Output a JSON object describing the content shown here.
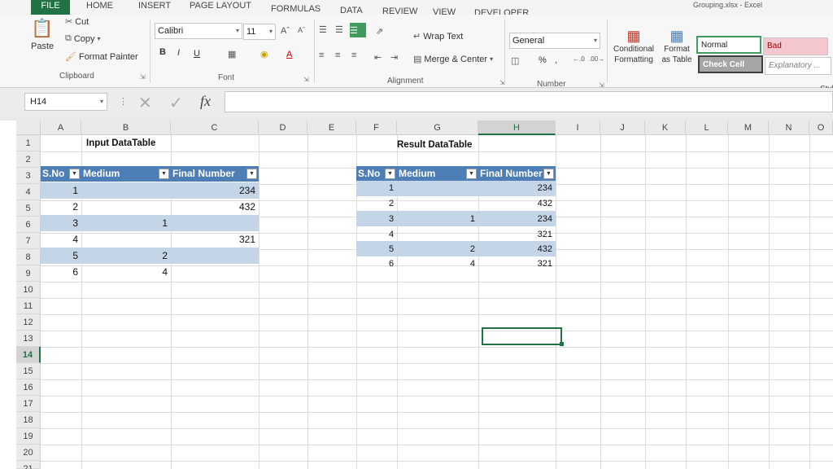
{
  "window": {
    "title": "Grouping.xlsx - Excel"
  },
  "tabs": [
    "FILE",
    "HOME",
    "INSERT",
    "PAGE LAYOUT",
    "FORMULAS",
    "DATA",
    "REVIEW",
    "VIEW",
    "DEVELOPER"
  ],
  "ribbon": {
    "clipboard": {
      "paste": "Paste",
      "cut": "Cut",
      "copy": "Copy",
      "format_painter": "Format Painter",
      "label": "Clipboard"
    },
    "font": {
      "name": "Calibri",
      "size": "11",
      "bold": "B",
      "italic": "I",
      "underline": "U",
      "label": "Font"
    },
    "alignment": {
      "wrap_text": "Wrap Text",
      "merge_center": "Merge & Center",
      "label": "Alignment"
    },
    "number": {
      "format": "General",
      "percent": "%",
      "comma": ",",
      "label": "Number"
    },
    "styles": {
      "conditional_formatting": "Conditional Formatting",
      "format_as_table": "Format as Table",
      "normal": "Normal",
      "bad": "Bad",
      "check_cell": "Check Cell",
      "explanatory": "Explanatory ...",
      "label": "Styl"
    }
  },
  "formula_bar": {
    "name_box": "H14",
    "fx": "fx",
    "value": ""
  },
  "columns": [
    "A",
    "B",
    "C",
    "D",
    "E",
    "F",
    "G",
    "H",
    "I",
    "J",
    "K",
    "L",
    "M",
    "N",
    "O"
  ],
  "rows": [
    "1",
    "2",
    "3",
    "4",
    "5",
    "6",
    "7",
    "8",
    "9",
    "10",
    "11",
    "12",
    "13",
    "14",
    "15",
    "16",
    "17",
    "18",
    "19",
    "20",
    "21"
  ],
  "active_cell": {
    "column": "H",
    "row": "14"
  },
  "input_table": {
    "title": "Input DataTable",
    "headers": [
      "S.No",
      "Medium",
      "Final Number"
    ],
    "rows": [
      {
        "sno": "1",
        "medium": "",
        "final": "234"
      },
      {
        "sno": "2",
        "medium": "",
        "final": "432"
      },
      {
        "sno": "3",
        "medium": "1",
        "final": ""
      },
      {
        "sno": "4",
        "medium": "",
        "final": "321"
      },
      {
        "sno": "5",
        "medium": "2",
        "final": ""
      },
      {
        "sno": "6",
        "medium": "4",
        "final": ""
      }
    ]
  },
  "result_table": {
    "title": "Result DataTable",
    "headers": [
      "S.No",
      "Medium",
      "Final Number"
    ],
    "rows": [
      {
        "sno": "1",
        "medium": "",
        "final": "234"
      },
      {
        "sno": "2",
        "medium": "",
        "final": "432"
      },
      {
        "sno": "3",
        "medium": "1",
        "final": "234"
      },
      {
        "sno": "4",
        "medium": "",
        "final": "321"
      },
      {
        "sno": "5",
        "medium": "2",
        "final": "432"
      },
      {
        "sno": "6",
        "medium": "4",
        "final": "321"
      }
    ]
  },
  "colors": {
    "accent": "#217346",
    "table_header": "#4e7eb6",
    "table_band": "#c5d5e8",
    "bad_style": "#f4c7ce",
    "check_cell": "#a5a5a5"
  }
}
